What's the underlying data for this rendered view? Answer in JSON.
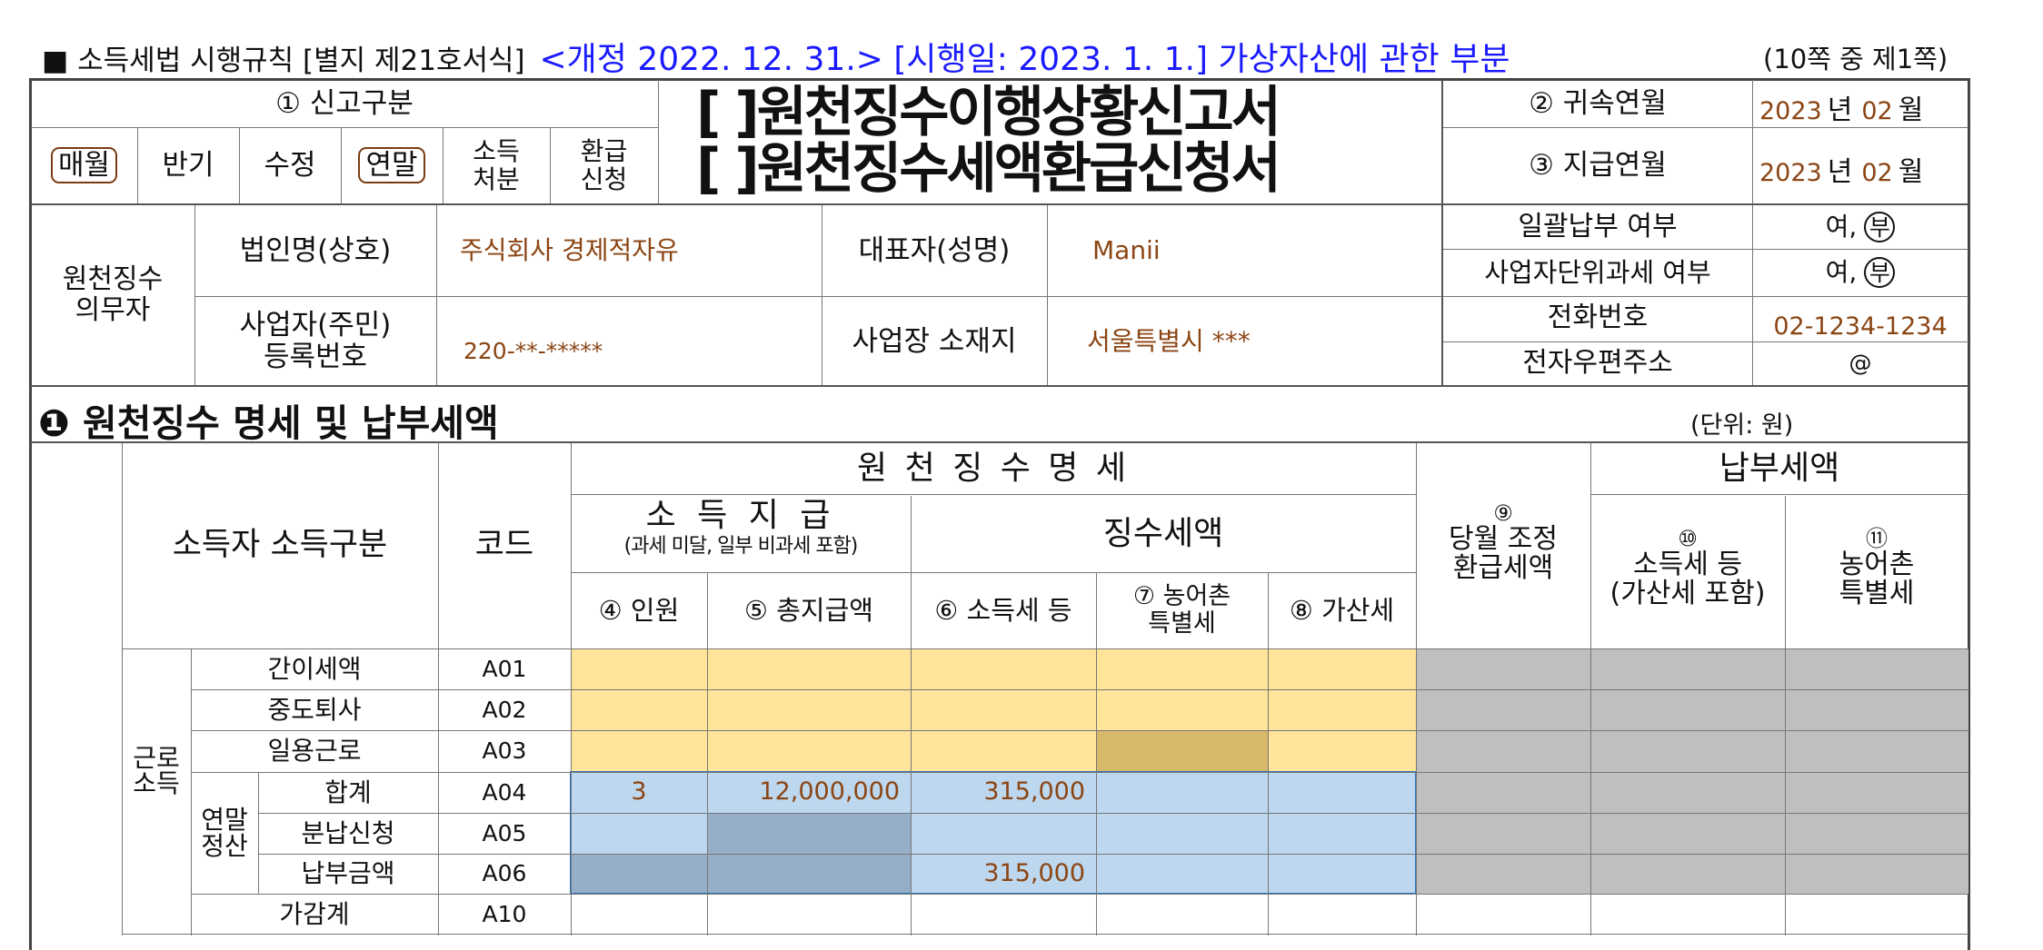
{
  "form_header": {
    "prefix": "■ 소득세법 시행규칙 [별지 제21호서식]",
    "amendment": "<개정 2022. 12. 31.> [시행일: 2023. 1. 1.] 가상자산에 관한 부분",
    "page": "(10쪽 중 제1쪽)"
  },
  "report_type": {
    "label": "① 신고구분",
    "options": [
      {
        "label": "매월",
        "circled": true
      },
      {
        "label": "반기",
        "circled": false
      },
      {
        "label": "수정",
        "circled": false
      },
      {
        "label": "연말",
        "circled": true
      },
      {
        "label": "소득\n처분",
        "circled": false
      },
      {
        "label": "환급\n신청",
        "circled": false
      }
    ]
  },
  "title": {
    "line1": "[ ]원천징수이행상황신고서",
    "line2": "[ ]원천징수세액환급신청서"
  },
  "period": {
    "attribution_label": "② 귀속연월",
    "attribution_year": "2023",
    "attribution_month": "02",
    "payment_label": "③ 지급연월",
    "payment_year": "2023",
    "payment_month": "02",
    "year_unit": "년",
    "month_unit": "월"
  },
  "withholder": {
    "group_label": "원천징수\n의무자",
    "corp_name_label": "법인명(상호)",
    "corp_name": "주식회사 경제적자유",
    "rep_label": "대표자(성명)",
    "rep_name": "Manii",
    "reg_label": "사업자(주민)\n등록번호",
    "reg_number": "220-**-*****",
    "address_label": "사업장 소재지",
    "address": "서울특별시 ***",
    "bulk_payment_label": "일괄납부 여부",
    "bulk_yes": "여,",
    "bulk_no": "부",
    "unit_tax_label": "사업자단위과세 여부",
    "unit_yes": "여,",
    "unit_no": "부",
    "phone_label": "전화번호",
    "phone": "02-1234-1234",
    "email_label": "전자우편주소",
    "email": "@"
  },
  "section1": {
    "title": "❶ 원천징수 명세 및 납부세액",
    "unit": "(단위: 원)",
    "header_withholding": "원 천 징 수 명 세",
    "header_payment": "납부세액",
    "header_income_type": "소득자 소득구분",
    "header_code": "코드",
    "header_income_paid": "소 득 지 급",
    "header_income_paid_sub": "(과세 미달, 일부 비과세 포함)",
    "header_tax_collected": "징수세액",
    "col_persons": "④ 인원",
    "col_total_paid": "⑤ 총지급액",
    "col_income_tax": "⑥ 소득세 등",
    "col_rural_tax": "⑦ 농어촌\n특별세",
    "col_penalty": "⑧ 가산세",
    "col_refund_num": "⑨",
    "col_refund": "당월 조정\n환급세액",
    "col_pay_income_num": "⑩",
    "col_pay_income": "소득세 등\n(가산세 포함)",
    "col_pay_rural_num": "⑪",
    "col_pay_rural": "농어촌\n특별세",
    "category_labor": "근로\n소득",
    "subgroup_year_end": "연말\n정산",
    "rows": [
      {
        "label": "간이세액",
        "code": "A01",
        "persons": "",
        "total_paid": "",
        "income_tax": "",
        "rural_tax": "",
        "penalty": ""
      },
      {
        "label": "중도퇴사",
        "code": "A02",
        "persons": "",
        "total_paid": "",
        "income_tax": "",
        "rural_tax": "",
        "penalty": ""
      },
      {
        "label": "일용근로",
        "code": "A03",
        "persons": "",
        "total_paid": "",
        "income_tax": "",
        "rural_tax": "",
        "penalty": ""
      },
      {
        "label": "합계",
        "code": "A04",
        "persons": "3",
        "total_paid": "12,000,000",
        "income_tax": "315,000",
        "rural_tax": "",
        "penalty": ""
      },
      {
        "label": "분납신청",
        "code": "A05",
        "persons": "",
        "total_paid": "",
        "income_tax": "",
        "rural_tax": "",
        "penalty": ""
      },
      {
        "label": "납부금액",
        "code": "A06",
        "persons": "",
        "total_paid": "",
        "income_tax": "315,000",
        "rural_tax": "",
        "penalty": ""
      },
      {
        "label": "가감계",
        "code": "A10",
        "persons": "",
        "total_paid": "",
        "income_tax": "",
        "rural_tax": "",
        "penalty": ""
      }
    ]
  },
  "colors": {
    "yellow": "#FFE49A",
    "gray": "#BFBFBF",
    "blue": "#BDD7EE",
    "blue_dark": "#96AFC8",
    "olive": "#D8B86A",
    "brown_text": "#8B4513",
    "header_blue": "#1a1aff"
  }
}
